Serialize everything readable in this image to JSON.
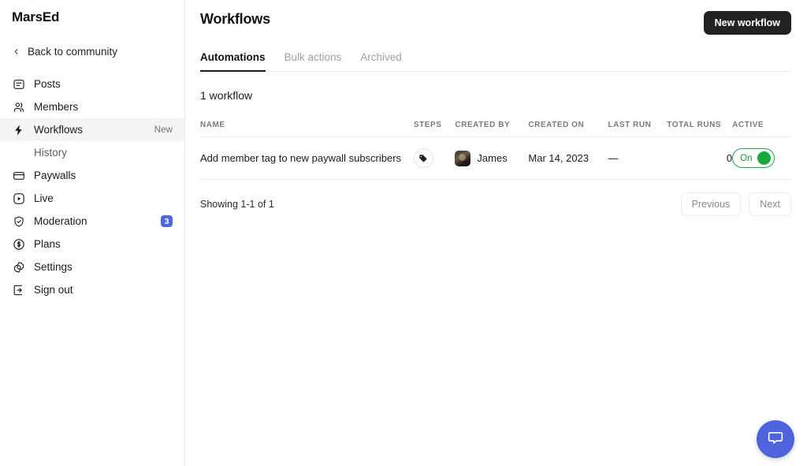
{
  "sidebar": {
    "brand": "MarsEd",
    "back": {
      "label": "Back to community",
      "icon": "chevron-left-icon"
    },
    "items": [
      {
        "label": "Posts",
        "icon": "posts-icon",
        "badge": null,
        "active": false
      },
      {
        "label": "Members",
        "icon": "members-icon",
        "badge": null,
        "active": false
      },
      {
        "label": "Workflows",
        "icon": "workflows-icon",
        "badge": "New",
        "active": true
      },
      {
        "label": "Paywalls",
        "icon": "paywalls-icon",
        "badge": null,
        "active": false
      },
      {
        "label": "Live",
        "icon": "live-icon",
        "badge": null,
        "active": false
      },
      {
        "label": "Moderation",
        "icon": "moderation-icon",
        "badge": "3",
        "active": false
      },
      {
        "label": "Plans",
        "icon": "plans-icon",
        "badge": null,
        "active": false
      },
      {
        "label": "Settings",
        "icon": "settings-icon",
        "badge": null,
        "active": false
      },
      {
        "label": "Sign out",
        "icon": "sign-out-icon",
        "badge": null,
        "active": false
      }
    ],
    "sub_item": {
      "label": "History",
      "parent": "Workflows"
    },
    "badge_colors": {
      "count_bg": "#4f67e4",
      "count_text": "#ffffff"
    }
  },
  "header": {
    "title": "Workflows",
    "primary_button": {
      "label": "New workflow",
      "bg": "#222222",
      "text": "#ffffff"
    }
  },
  "tabs": [
    {
      "label": "Automations",
      "active": true
    },
    {
      "label": "Bulk actions",
      "active": false
    },
    {
      "label": "Archived",
      "active": false
    }
  ],
  "main": {
    "count_line": "1 workflow",
    "table": {
      "columns": [
        "NAME",
        "STEPS",
        "CREATED BY",
        "CREATED ON",
        "LAST RUN",
        "TOTAL RUNS",
        "ACTIVE"
      ],
      "rows": [
        {
          "name": "Add member tag to new paywall subscribers",
          "steps_icon": "tag-icon",
          "created_by": "James",
          "created_on": "Mar 14, 2023",
          "last_run": "—",
          "total_runs": "0",
          "active": {
            "label": "On",
            "state": "on",
            "color": "#17ab3e"
          }
        }
      ]
    },
    "pagination": {
      "info": "Showing 1-1 of 1",
      "previous": "Previous",
      "next": "Next"
    }
  },
  "chat_widget": {
    "icon": "chat-bubble-icon",
    "color": "#4f63dd"
  }
}
